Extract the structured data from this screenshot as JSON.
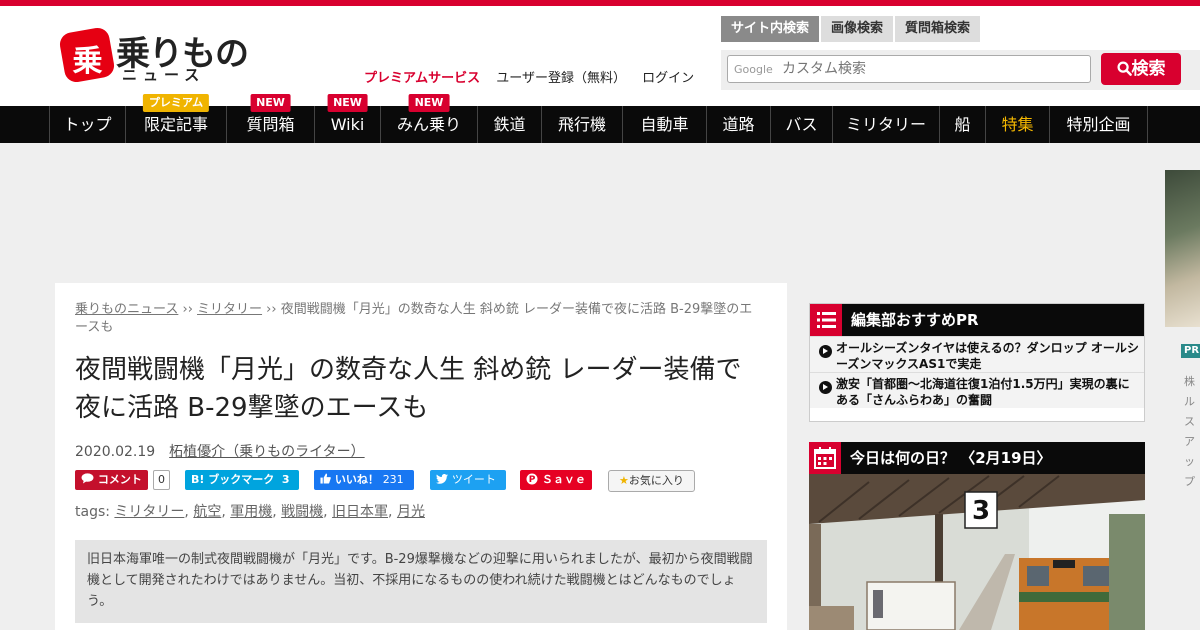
{
  "header": {
    "logo_main": "乗りもの",
    "logo_sub": "ニュース",
    "premium_label": "プレミアムサービス",
    "register_label": "ユーザー登録（無料）",
    "login_label": "ログイン"
  },
  "search": {
    "tabs": [
      "サイト内検索",
      "画像検索",
      "質問箱検索"
    ],
    "google_label": "Google",
    "placeholder": "カスタム検索",
    "button_label": "検索"
  },
  "nav": {
    "items": [
      {
        "label": "トップ",
        "badge": ""
      },
      {
        "label": "限定記事",
        "badge": "プレミアム"
      },
      {
        "label": "質問箱",
        "badge": "NEW"
      },
      {
        "label": "Wiki",
        "badge": "NEW"
      },
      {
        "label": "みん乗り",
        "badge": "NEW"
      },
      {
        "label": "鉄道",
        "badge": ""
      },
      {
        "label": "飛行機",
        "badge": ""
      },
      {
        "label": "自動車",
        "badge": ""
      },
      {
        "label": "道路",
        "badge": ""
      },
      {
        "label": "バス",
        "badge": ""
      },
      {
        "label": "ミリタリー",
        "badge": ""
      },
      {
        "label": "船",
        "badge": ""
      },
      {
        "label": "特集",
        "badge": ""
      },
      {
        "label": "特別企画",
        "badge": ""
      }
    ]
  },
  "article": {
    "breadcrumb": {
      "home": "乗りものニュース",
      "sep1": " ›› ",
      "category": "ミリタリー",
      "sep2": " ›› ",
      "current": "夜間戦闘機「月光」の数奇な人生 斜め銃 レーダー装備で夜に活路 B-29撃墜のエースも"
    },
    "title": "夜間戦闘機「月光」の数奇な人生 斜め銃 レーダー装備で夜に活路 B-29撃墜のエースも",
    "date": "2020.02.19",
    "author": "柘植優介（乗りものライター）",
    "share": {
      "comment": "コメント",
      "comment_count": "0",
      "hatena": "B! ブックマーク",
      "hatena_count": "3",
      "like": "いいね！",
      "like_count": "231",
      "tweet": "ツイート",
      "pin": "Ｓａｖｅ",
      "favorite": "お気に入り"
    },
    "tags_label": "tags: ",
    "tags": [
      "ミリタリー",
      "航空",
      "軍用機",
      "戦闘機",
      "旧日本軍",
      "月光"
    ],
    "lead": "旧日本海軍唯一の制式夜間戦闘機が「月光」です。B-29爆撃機などの迎撃に用いられましたが、最初から夜間戦闘機として開発されたわけではありません。当初、不採用になるものの使われ続けた戦闘機とはどんなものでしょう。"
  },
  "sidebar": {
    "pr_title": "編集部おすすめPR",
    "pr_items": [
      "オールシーズンタイヤは使えるの？ダンロップ オールシーズンマックスAS1で実走",
      "激安「首都圏～北海道往復1泊付1.5万円」実現の裏にある「さんふらわあ」の奮闘"
    ],
    "today_title": "今日は何の日？ 〈2月19日〉",
    "right_pr": "PR",
    "right_text": "株ルスアップ"
  },
  "colors": {
    "brand_red": "#d8002f",
    "nav_bg": "#0a0a0a",
    "tokushu": "#f5b800"
  }
}
